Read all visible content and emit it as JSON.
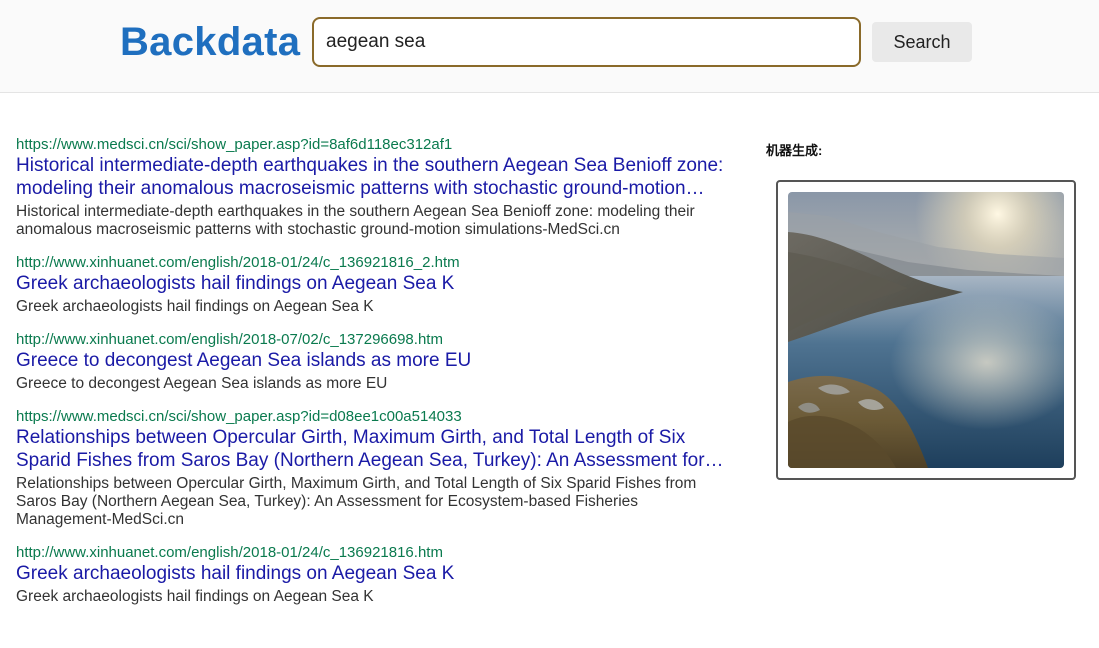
{
  "header": {
    "logo": "Backdata",
    "search_value": "aegean sea",
    "search_button": "Search"
  },
  "results": [
    {
      "url": "https://www.medsci.cn/sci/show_paper.asp?id=8af6d118ec312af1",
      "title": "Historical intermediate-depth earthquakes in the southern Aegean Sea Benioff zone: modeling their anomalous macroseismic patterns with stochastic ground-motion simulations-MedSci.cn",
      "snippet": "Historical intermediate-depth earthquakes in the southern Aegean Sea Benioff zone: modeling their anomalous macroseismic patterns with stochastic ground-motion simulations-MedSci.cn"
    },
    {
      "url": "http://www.xinhuanet.com/english/2018-01/24/c_136921816_2.htm",
      "title": "Greek archaeologists hail findings on Aegean Sea K",
      "snippet": "Greek archaeologists hail findings on Aegean Sea K"
    },
    {
      "url": "http://www.xinhuanet.com/english/2018-07/02/c_137296698.htm",
      "title": "Greece to decongest Aegean Sea islands as more EU",
      "snippet": "Greece to decongest Aegean Sea islands as more EU"
    },
    {
      "url": "https://www.medsci.cn/sci/show_paper.asp?id=d08ee1c00a514033",
      "title": "Relationships between Opercular Girth, Maximum Girth, and Total Length of Six Sparid Fishes from Saros Bay (Northern Aegean Sea, Turkey): An Assessment for Ecosystem-based Fisheries Management-MedSci.cn",
      "snippet": "Relationships between Opercular Girth, Maximum Girth, and Total Length of Six Sparid Fishes from Saros Bay (Northern Aegean Sea, Turkey): An Assessment for Ecosystem-based Fisheries Management-MedSci.cn"
    },
    {
      "url": "http://www.xinhuanet.com/english/2018-01/24/c_136921816.htm",
      "title": "Greek archaeologists hail findings on Aegean Sea K",
      "snippet": "Greek archaeologists hail findings on Aegean Sea K"
    }
  ],
  "sidebar": {
    "label": "机器生成:"
  },
  "colors": {
    "brand": "#1f6fbf",
    "url": "#0a7a4e",
    "title": "#1a1aa6"
  }
}
